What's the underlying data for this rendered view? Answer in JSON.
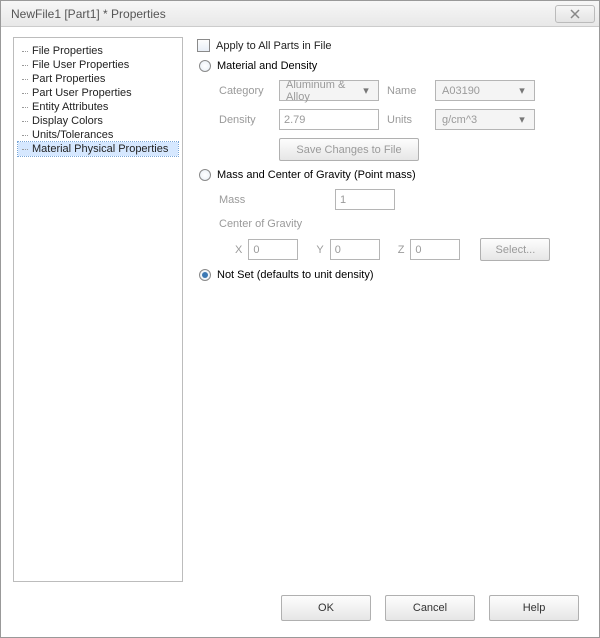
{
  "window": {
    "title": "NewFile1 [Part1] * Properties"
  },
  "tree": {
    "items": [
      "File Properties",
      "File User Properties",
      "Part Properties",
      "Part User Properties",
      "Entity Attributes",
      "Display Colors",
      "Units/Tolerances",
      "Material Physical Properties"
    ],
    "selected_index": 7
  },
  "main": {
    "apply_all_label": "Apply to All Parts in File",
    "material_density": {
      "label": "Material and Density",
      "category_label": "Category",
      "category_value": "Aluminum & Alloy",
      "name_label": "Name",
      "name_value": "A03190",
      "density_label": "Density",
      "density_value": "2.79",
      "units_label": "Units",
      "units_value": "g/cm^3",
      "save_button": "Save Changes to File"
    },
    "mass_cg": {
      "label": "Mass and Center of Gravity (Point mass)",
      "mass_label": "Mass",
      "mass_value": "1",
      "cg_label": "Center of Gravity",
      "x_label": "X",
      "x_value": "0",
      "y_label": "Y",
      "y_value": "0",
      "z_label": "Z",
      "z_value": "0",
      "select_button": "Select..."
    },
    "not_set": {
      "label": "Not Set (defaults to unit density)"
    }
  },
  "footer": {
    "ok": "OK",
    "cancel": "Cancel",
    "help": "Help"
  }
}
